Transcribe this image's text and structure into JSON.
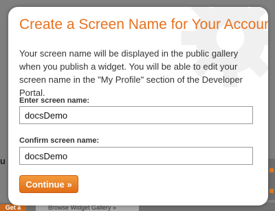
{
  "dialog": {
    "title": "Create a Screen Name for Your Account",
    "description": "Your screen name will be displayed in the public gallery when you publish a widget. You will be able to edit your screen name in the \"My Profile\" section of the Developer Portal.",
    "fields": [
      {
        "label": "Enter screen name:",
        "value": "docsDemo"
      },
      {
        "label": "Confirm screen name:",
        "value": "docsDemo"
      }
    ],
    "continue_label": "Continue »"
  },
  "background": {
    "partial_letter": "u",
    "button_left_label": "Get a",
    "button_right_label": "Browse Widget Gallery »"
  },
  "colors": {
    "accent": "#e8711e",
    "text": "#333333",
    "overlay": "#7f7f7f"
  }
}
